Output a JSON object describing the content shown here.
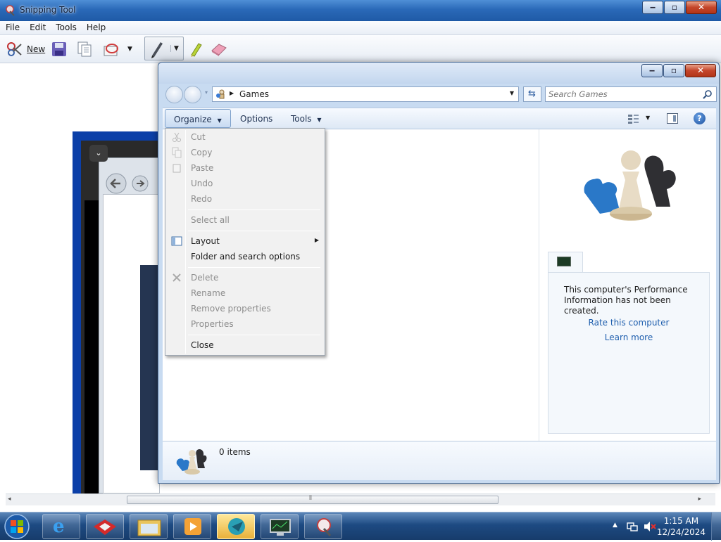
{
  "snip": {
    "title": "Snipping Tool",
    "menu": [
      "File",
      "Edit",
      "Tools",
      "Help"
    ],
    "toolbar": {
      "new_label": "New"
    }
  },
  "games": {
    "address": {
      "crumb": "Games"
    },
    "search": {
      "placeholder": "Search Games"
    },
    "commands": {
      "organize": "Organize",
      "options": "Options",
      "tools": "Tools"
    },
    "perf": {
      "message": "This computer's Performance Information has not been created.",
      "rate_link": "Rate this computer",
      "learn_link": "Learn more"
    },
    "status": {
      "count": "0 items"
    }
  },
  "organize_menu": {
    "items": [
      {
        "label": "Cut",
        "enabled": false
      },
      {
        "label": "Copy",
        "enabled": false
      },
      {
        "label": "Paste",
        "enabled": false
      },
      {
        "label": "Undo",
        "enabled": false
      },
      {
        "label": "Redo",
        "enabled": false
      },
      {
        "label": "Select all",
        "enabled": false
      },
      {
        "label": "Layout",
        "enabled": true,
        "submenu": true
      },
      {
        "label": "Folder and search options",
        "enabled": true
      },
      {
        "label": "Delete",
        "enabled": false
      },
      {
        "label": "Rename",
        "enabled": false
      },
      {
        "label": "Remove properties",
        "enabled": false
      },
      {
        "label": "Properties",
        "enabled": false
      },
      {
        "label": "Close",
        "enabled": true
      }
    ]
  },
  "taskbar": {
    "apps": [
      "internet-explorer",
      "toolbox",
      "file-explorer",
      "media-player",
      "game-app",
      "task-manager",
      "snipping-tool"
    ],
    "clock": {
      "time": "1:15 AM",
      "date": "12/24/2024"
    }
  }
}
